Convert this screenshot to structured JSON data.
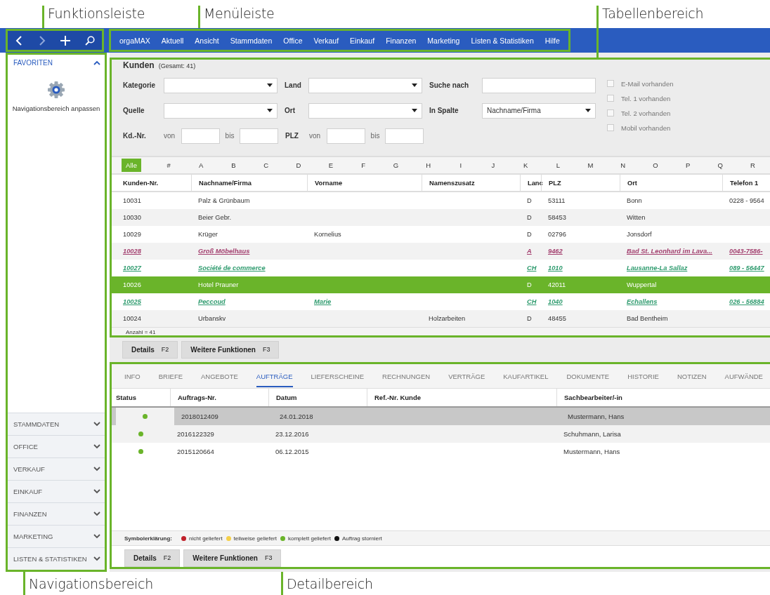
{
  "annotations_top": [
    {
      "label": "Funktionsleiste"
    },
    {
      "label": "Menüleiste"
    },
    {
      "label": "Tabellenbereich"
    }
  ],
  "annotations_bottom": [
    {
      "label": "Navigationsbereich"
    },
    {
      "label": "Detailbereich"
    }
  ],
  "nav_buttons": [
    {
      "kind": "back",
      "disabled": false
    },
    {
      "kind": "forward",
      "disabled": true
    },
    {
      "kind": "add",
      "disabled": false
    },
    {
      "kind": "search",
      "disabled": false
    }
  ],
  "menu": [
    "orgaMAX",
    "Aktuell",
    "Ansicht",
    "Stammdaten",
    "Office",
    "Verkauf",
    "Einkauf",
    "Finanzen",
    "Marketing",
    "Listen & Statistiken",
    "Hilfe"
  ],
  "sidebar": {
    "favorites": {
      "title": "FAVORITEN",
      "expanded": true,
      "action": "Navigationsbereich anpassen"
    },
    "sections": [
      {
        "title": "STAMMDATEN",
        "expanded": false
      },
      {
        "title": "OFFICE",
        "expanded": false
      },
      {
        "title": "VERKAUF",
        "expanded": false
      },
      {
        "title": "EINKAUF",
        "expanded": false
      },
      {
        "title": "FINANZEN",
        "expanded": false
      },
      {
        "title": "MARKETING",
        "expanded": false
      },
      {
        "title": "LISTEN & STATISTIKEN",
        "expanded": false
      }
    ]
  },
  "customers": {
    "title": "Kunden",
    "total": "(Gesamt: 41)",
    "filter_rows": [
      [
        {
          "kind": "select",
          "label": "Kategorie"
        },
        {
          "kind": "select",
          "label": "Land"
        },
        {
          "kind": "text",
          "label": "Suche nach"
        }
      ],
      [
        {
          "kind": "select",
          "label": "Quelle"
        },
        {
          "kind": "select",
          "label": "Ort"
        },
        {
          "kind": "select",
          "label": "In Spalte",
          "value": "Nachname/Firma"
        }
      ],
      [
        {
          "kind": "range",
          "label": "Kd.-Nr.",
          "from": "von",
          "to": "bis"
        },
        {
          "kind": "range",
          "label": "PLZ",
          "from": "von",
          "to": "bis"
        }
      ]
    ],
    "checkboxes": [
      {
        "label": "E-Mail vorhanden",
        "checked": false
      },
      {
        "label": "Tel. 1 vorhanden",
        "checked": false
      },
      {
        "label": "Tel. 2 vorhanden",
        "checked": false
      },
      {
        "label": "Mobil vorhanden",
        "checked": false
      }
    ],
    "letters": [
      {
        "label": "Alle",
        "selected": true
      },
      {
        "label": "#",
        "selected": false
      },
      {
        "label": "A",
        "selected": false
      },
      {
        "label": "B",
        "selected": false
      },
      {
        "label": "C",
        "selected": false
      },
      {
        "label": "D",
        "selected": false
      },
      {
        "label": "E",
        "selected": false
      },
      {
        "label": "F",
        "selected": false
      },
      {
        "label": "G",
        "selected": false
      },
      {
        "label": "H",
        "selected": false
      },
      {
        "label": "I",
        "selected": false
      },
      {
        "label": "J",
        "selected": false
      },
      {
        "label": "K",
        "selected": false
      },
      {
        "label": "L",
        "selected": false
      },
      {
        "label": "M",
        "selected": false
      },
      {
        "label": "N",
        "selected": false
      },
      {
        "label": "O",
        "selected": false
      },
      {
        "label": "P",
        "selected": false
      },
      {
        "label": "Q",
        "selected": false
      },
      {
        "label": "R",
        "selected": false
      }
    ],
    "columns": [
      "Kunden-Nr.",
      "Nachname/Firma",
      "Vorname",
      "Namenszusatz",
      "Lanc",
      "PLZ",
      "Ort",
      "Telefon 1"
    ],
    "rows": [
      {
        "selected": false,
        "cells": [
          "10031",
          "Palz & Grünbaum",
          "",
          "",
          "D",
          "53111",
          "Bonn",
          "0228 - 9564"
        ]
      },
      {
        "selected": false,
        "cells": [
          "10030",
          "Beier Gebr.",
          "",
          "",
          "D",
          "58453",
          "Witten",
          ""
        ]
      },
      {
        "selected": false,
        "cells": [
          "10029",
          "Krüger",
          "Kornelius",
          "",
          "D",
          "02796",
          "Jonsdorf",
          ""
        ]
      },
      {
        "selected": false,
        "color": "#a3406f",
        "cells": [
          "10028",
          "Groß Möbelhaus",
          "",
          "",
          "A",
          "9462",
          "Bad St. Leonhard im Lava...",
          "0043-7586-"
        ]
      },
      {
        "selected": false,
        "color": "#2e9b6e",
        "cells": [
          "10027",
          "Société de commerce",
          "",
          "",
          "CH",
          "1010",
          "Lausanne-La Sallaz",
          "089 - 56447"
        ]
      },
      {
        "selected": true,
        "cells": [
          "10026",
          "Hotel Prauner",
          "",
          "",
          "D",
          "42011",
          "Wuppertal",
          ""
        ]
      },
      {
        "selected": false,
        "color": "#2e9b6e",
        "cells": [
          "10025",
          "Peccoud",
          "Marie",
          "",
          "CH",
          "1040",
          "Echallens",
          "026 - 56884"
        ]
      },
      {
        "selected": false,
        "cells": [
          "10024",
          "Urbanskv",
          "",
          "Holzarbeiten",
          "D",
          "48455",
          "Bad Bentheim",
          ""
        ]
      }
    ],
    "count": "Anzahl = 41"
  },
  "buttons": [
    {
      "label": "Details",
      "key": "F2"
    },
    {
      "label": "Weitere Funktionen",
      "key": "F3"
    }
  ],
  "detail": {
    "tabs": [
      {
        "label": "INFO",
        "selected": false
      },
      {
        "label": "BRIEFE",
        "selected": false
      },
      {
        "label": "ANGEBOTE",
        "selected": false
      },
      {
        "label": "AUFTRÄGE",
        "selected": true
      },
      {
        "label": "LIEFERSCHEINE",
        "selected": false
      },
      {
        "label": "RECHNUNGEN",
        "selected": false
      },
      {
        "label": "VERTRÄGE",
        "selected": false
      },
      {
        "label": "KAUFARTIKEL",
        "selected": false
      },
      {
        "label": "DOKUMENTE",
        "selected": false
      },
      {
        "label": "HISTORIE",
        "selected": false
      },
      {
        "label": "NOTIZEN",
        "selected": false
      },
      {
        "label": "AUFWÄNDE",
        "selected": false
      }
    ],
    "columns": [
      "Status",
      "Auftrags-Nr.",
      "Datum",
      "Ref.-Nr. Kunde",
      "Sachbearbeiter/-in"
    ],
    "rows": [
      {
        "selected": true,
        "color": "#6ab42a",
        "cells": [
          "",
          "2018012409",
          "24.01.2018",
          "",
          "Mustermann, Hans"
        ]
      },
      {
        "selected": false,
        "color": "#6ab42a",
        "cells": [
          "",
          "2016122329",
          "23.12.2016",
          "",
          "Schuhmann, Larisa"
        ]
      },
      {
        "selected": false,
        "color": "#6ab42a",
        "cells": [
          "",
          "2015120664",
          "06.12.2015",
          "",
          "Mustermann, Hans"
        ]
      }
    ],
    "legend_title": "Symbolerklärung:",
    "legend": [
      {
        "label": "nicht geliefert",
        "color": "#c0202a"
      },
      {
        "label": "teilweise geliefert",
        "color": "#f5d04a"
      },
      {
        "label": "komplett geliefert",
        "color": "#6ab42a"
      },
      {
        "label": "Auftrag storniert",
        "color": "#111111"
      }
    ],
    "buttons": [
      {
        "label": "Details",
        "key": "F2"
      },
      {
        "label": "Weitere Funktionen",
        "key": "F3"
      }
    ]
  }
}
